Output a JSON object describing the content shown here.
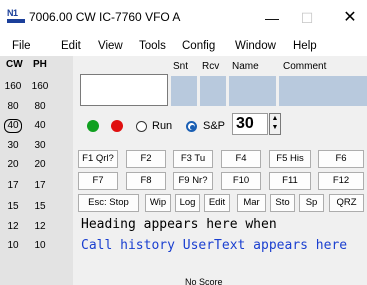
{
  "window": {
    "title": "7006.00 CW IC-7760 VFO A",
    "icon_text": "N1",
    "minimize": "—",
    "maximize": "☐",
    "close": "✕"
  },
  "menu": [
    "File",
    "Edit",
    "View",
    "Tools",
    "Config",
    "Window",
    "Help"
  ],
  "bands": {
    "headers": [
      "CW",
      "PH"
    ],
    "rows": [
      [
        "160",
        "160"
      ],
      [
        "80",
        "80"
      ],
      [
        "40",
        "40"
      ],
      [
        "30",
        "30"
      ],
      [
        "20",
        "20"
      ],
      [
        "17",
        "17"
      ],
      [
        "15",
        "15"
      ],
      [
        "12",
        "12"
      ],
      [
        "10",
        "10"
      ]
    ],
    "selected": "40"
  },
  "entry": {
    "columns": [
      "Snt",
      "Rcv",
      "Name",
      "Comment"
    ],
    "call_value": ""
  },
  "mode": {
    "run_label": "Run",
    "sp_label": "S&P",
    "selected": "S&P",
    "status_colors": {
      "left": "#10a020",
      "right": "#e01010"
    }
  },
  "cq_repeat": "30",
  "spinner": {
    "up": "▲",
    "down": "▼"
  },
  "function_keys": {
    "row1": [
      "F1 Qrl?",
      "F2",
      "F3 Tu",
      "F4",
      "F5 His",
      "F6"
    ],
    "row2": [
      "F7",
      "F8",
      "F9 Nr?",
      "F10",
      "F11",
      "F12"
    ],
    "row3": [
      "Esc: Stop",
      "Wip",
      "Log",
      "Edit",
      "Mar",
      "Sto",
      "Sp",
      "QRZ"
    ]
  },
  "messages": {
    "heading": "Heading appears here when",
    "call_history": "Call history UserText appears here"
  },
  "status": {
    "score": "No Score"
  }
}
